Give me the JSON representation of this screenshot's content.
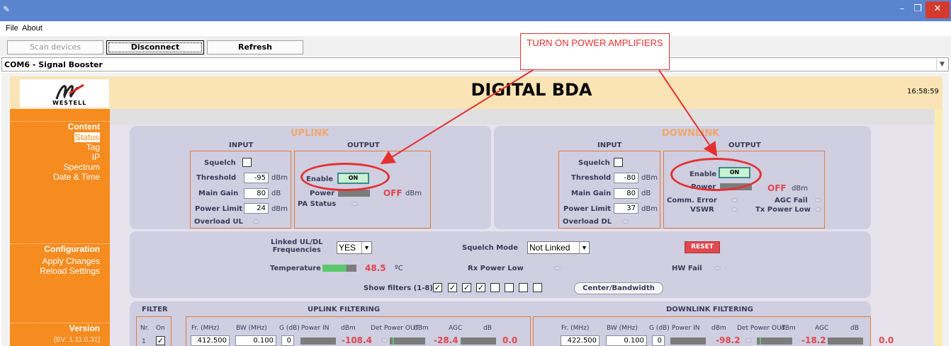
{
  "window": {
    "min": "–",
    "max": "❐",
    "close": "✕",
    "app_icon": "feather-icon"
  },
  "menu": {
    "file": "File",
    "about": "About"
  },
  "toolbar": {
    "scan": "Scan devices",
    "disconnect": "Disconnect",
    "refresh": "Refresh"
  },
  "device": {
    "selected": "COM6 - Signal Booster"
  },
  "header": {
    "title": "DIGITAL BDA",
    "time": "16:58:59",
    "logo_text": "WESTELL"
  },
  "sidebar": {
    "content_title": "Content",
    "content_items": [
      "Status",
      "Tag",
      "IP",
      "Spectrum",
      "Date & Time"
    ],
    "config_title": "Configuration",
    "config_items": [
      "Apply Changes",
      "Reload Settings"
    ],
    "version_title": "Version",
    "version_value": "[BV: 1.11.0.31]"
  },
  "uplink": {
    "title": "UPLINK",
    "input_title": "INPUT",
    "output_title": "OUTPUT",
    "squelch": "Squelch",
    "threshold_label": "Threshold",
    "threshold": "-95",
    "threshold_unit": "dBm",
    "gain_label": "Main Gain",
    "gain": "80",
    "gain_unit": "dB",
    "limit_label": "Power Limit",
    "limit": "24",
    "limit_unit": "dBm",
    "overload": "Overload UL",
    "enable": "Enable",
    "on": "ON",
    "power": "Power",
    "power_state": "OFF",
    "power_unit": "dBm",
    "pa_status": "PA Status"
  },
  "downlink": {
    "title": "DOWNLINK",
    "input_title": "INPUT",
    "output_title": "OUTPUT",
    "squelch": "Squelch",
    "threshold_label": "Threshold",
    "threshold": "-80",
    "threshold_unit": "dBm",
    "gain_label": "Main Gain",
    "gain": "80",
    "gain_unit": "dB",
    "limit_label": "Power Limit",
    "limit": "37",
    "limit_unit": "dBm",
    "overload": "Overload DL",
    "enable": "Enable",
    "on": "ON",
    "power": "Power",
    "power_state": "OFF",
    "power_unit": "dBm",
    "comm_error": "Comm. Error",
    "agc_fail": "AGC Fail",
    "vswr": "VSWR",
    "tx_low": "Tx Power Low"
  },
  "config": {
    "linked_label": "Linked UL/DL\nFrequencies",
    "linked_value": "YES",
    "squelch_mode_label": "Squelch Mode",
    "squelch_mode_value": "Not Linked",
    "reset": "RESET",
    "temp_label": "Temperature",
    "temp_value": "48.5",
    "temp_unit": "ºC",
    "rx_low": "Rx Power Low",
    "hw_fail": "HW Fail",
    "show_filters": "Show filters (1-8)",
    "filters_checked": [
      true,
      true,
      true,
      true,
      false,
      false,
      false,
      false
    ],
    "center_btn": "Center/Bandwidth"
  },
  "filter": {
    "title": "FILTER",
    "uplink_title": "UPLINK FILTERING",
    "downlink_title": "DOWNLINK FILTERING",
    "nr": "Nr.",
    "on": "On",
    "cols": [
      "Fr. (MHz)",
      "BW (MHz)",
      "G (dB)",
      "Power IN",
      "dBm",
      "Det Power OUT",
      "dBm",
      "AGC",
      "dB"
    ],
    "row1": {
      "nr": "1",
      "ul": {
        "fr": "412.500",
        "bw": "0.100",
        "g": "0",
        "pin": "-108.4",
        "pout": "-28.4",
        "agc": "0.0"
      },
      "dl": {
        "fr": "422.500",
        "bw": "0.100",
        "g": "0",
        "pin": "-98.2",
        "pout": "-18.2",
        "agc": "0.0"
      }
    }
  },
  "annotation": {
    "text": "TURN ON POWER AMPLIFIERS"
  }
}
